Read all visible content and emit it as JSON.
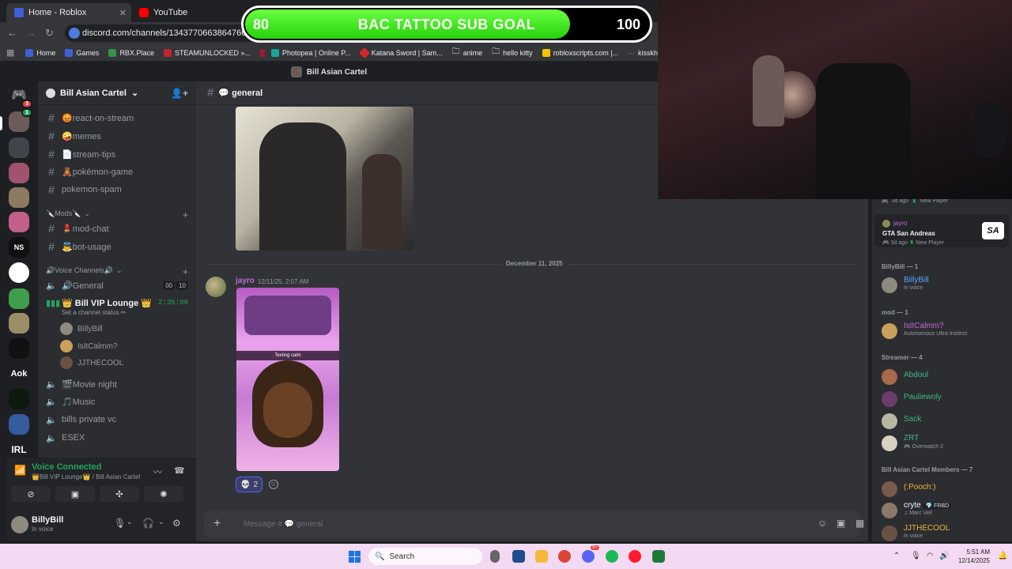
{
  "browser": {
    "tabs": [
      {
        "label": "Home - Roblox"
      },
      {
        "label": "YouTube"
      }
    ],
    "url": "discord.com/channels/1343770663864766484/13",
    "bookmarks": [
      "Home",
      "Games",
      "RBX.Place",
      "STEAMUNLOCKED »...",
      "Photopea | Online P...",
      "Katana Sword | Sam...",
      "anime",
      "hello kitty",
      "robloxscripts.com |...",
      "kisskh | Asian Dram..."
    ]
  },
  "overlay": {
    "goal_start": "80",
    "goal_title": "BAC TATTOO SUB GOAL",
    "goal_end": "100",
    "goal_progress": 0.8
  },
  "discord": {
    "window_title": "Bill Asian Cartel",
    "dm_badge": "3",
    "server_badge": "1",
    "server_rail_labels": {
      "ns": "NS",
      "aok": "Aok",
      "irl": "IRL"
    },
    "server_name": "Bill Asian Cartel",
    "channels": [
      {
        "name": "😡react-on-stream"
      },
      {
        "name": "🤪memes"
      },
      {
        "name": "📄stream-tips"
      },
      {
        "name": "🧸pokémon-game"
      },
      {
        "name": "pokemon-spam"
      }
    ],
    "mods_category": "🔪Mods🔪",
    "mods_channels": [
      {
        "name": "💄mod-chat"
      },
      {
        "name": "👼bot-usage"
      }
    ],
    "voice_category": "🔊Voice Channels🔊",
    "voice_channels": {
      "general": "🔊General",
      "general_pill_a": "00",
      "general_pill_b": "10",
      "vip": "👑 Bill VIP Lounge 👑",
      "vip_timer": "2:35:08",
      "vip_status": "Set a channel status ✏",
      "vip_users": [
        "BillyBill",
        "IsItCalmm?",
        "JJTHECOOL"
      ],
      "movie": "🎬Movie night",
      "music": "🎵Music",
      "bills": "bills private vc",
      "esex": "ESEX"
    },
    "voice_panel": {
      "title": "Voice Connected",
      "subtitle": "👑Bill VIP Lounge👑 / Bill Asian Cartel"
    },
    "user_panel": {
      "name": "BillyBill",
      "status": "In voice"
    },
    "chat": {
      "channel": "💬 general",
      "date_divider": "December 11, 2025",
      "message": {
        "author": "jayro",
        "time": "12/11/25, 2:07 AM",
        "image_caption": "Texting calm"
      },
      "reaction_emoji": "💀",
      "reaction_count": "2",
      "composer_placeholder": "Message # 💬 general"
    },
    "members": {
      "activity_top": "3d ago",
      "activity_top_tag": "New Player",
      "jayro": {
        "name": "jayro",
        "game": "GTA San Andreas",
        "ago": "3d ago",
        "tag": "New Player",
        "game_logo": "SA"
      },
      "groups": [
        {
          "title": "BillyBill — 1",
          "members": [
            {
              "name": "BillyBill",
              "status": "In voice",
              "color": "#5da5ff"
            }
          ]
        },
        {
          "title": "mod — 1",
          "members": [
            {
              "name": "IsItCalmm?",
              "status": "Autonomous Ultra Instinct",
              "color": "#c06bd4"
            }
          ]
        },
        {
          "title": "Streamer — 4",
          "members": [
            {
              "name": "Abdoul",
              "status": "",
              "color": "#43b581"
            },
            {
              "name": "Pauliewoly",
              "status": "",
              "color": "#43b581"
            },
            {
              "name": "Sack",
              "status": "",
              "color": "#43b581"
            },
            {
              "name": "ZRT",
              "status": "Overwatch 2",
              "color": "#43b581"
            }
          ]
        },
        {
          "title": "Bill Asian Cartel Members — 7",
          "members": [
            {
              "name": "(:Pooch:)",
              "status": "",
              "color": "#f0b232"
            },
            {
              "name": "cryte",
              "status": "Marc Veil",
              "color": "#f2f3f5",
              "tag": "FRBD"
            },
            {
              "name": "JJTHECOOL",
              "status": "In voice",
              "color": "#f0b232"
            }
          ]
        }
      ]
    }
  },
  "taskbar": {
    "search": "Search",
    "time": "5:51 AM",
    "date": "12/14/2025",
    "discord_badge": "9+"
  },
  "colors": {
    "accent_green": "#23a55a",
    "blurple": "#5865f2",
    "goal_green": "#3be01c"
  }
}
